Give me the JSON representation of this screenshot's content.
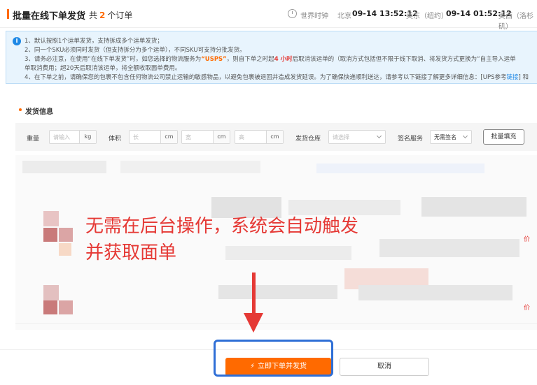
{
  "header": {
    "title": "批量在线下单发货",
    "order_prefix": "共",
    "order_count": "2",
    "order_suffix": "个订单",
    "world_time_label": "世界时钟",
    "clocks": [
      {
        "city": "北京",
        "time": "09-14 13:52:12"
      },
      {
        "city": "美东（纽约）",
        "time": "09-14 01:52:12"
      },
      {
        "city": "美西（洛杉矶）",
        "time": ""
      }
    ]
  },
  "notice": {
    "line1": "1、默认按照1个运单发货，支持拆成多个运单发货；",
    "line2": "2、同一个SKU必须同时发货（但支持拆分为多个运单），不同SKU可支持分批发货。",
    "line3_a": "3、请务必注意，在使用“在线下单发货”时，如您选择的物流服务为",
    "line3_hl": "“USPS”",
    "line3_b": "，则自下单之时起",
    "line3_hl2": "4 小时",
    "line3_c": "后取消该运单的（取消方式包括但不限于线下取消、将发货方式更换为“自主导入运单",
    "line3_d": "单取消费用；超20天后取消该运单，将全额收取面单费用。",
    "line4_a": "4、在下单之前，请确保您的包裹不包含任何物流公司禁止运输的敏感物品，以避免包裹被退回并造成发货延误。为了确保快递顺利送达，请参考以下链接了解更多详细信息：[UPS参考",
    "line4_link": "链接",
    "line4_b": "] 和"
  },
  "section": {
    "title": "发货信息"
  },
  "form": {
    "weight_label": "重量",
    "weight_placeholder": "请输入",
    "weight_unit": "kg",
    "volume_label": "体积",
    "length_placeholder": "长",
    "width_placeholder": "宽",
    "height_placeholder": "高",
    "dim_unit": "cm",
    "warehouse_label": "发货仓库",
    "warehouse_placeholder": "请选择",
    "sign_label": "签名服务",
    "sign_value": "无需签名",
    "batch_fill": "批量填充"
  },
  "annotation": {
    "line1": "无需在后台操作，系统会自动触发",
    "line2": "并获取面单"
  },
  "footer": {
    "submit": "立即下单并发货",
    "cancel": "取消"
  },
  "colors": {
    "accent": "#ff6a00",
    "annotation_red": "#e53935",
    "highlight_blue": "#2f6fd6",
    "info_blue": "#1e88e5"
  }
}
